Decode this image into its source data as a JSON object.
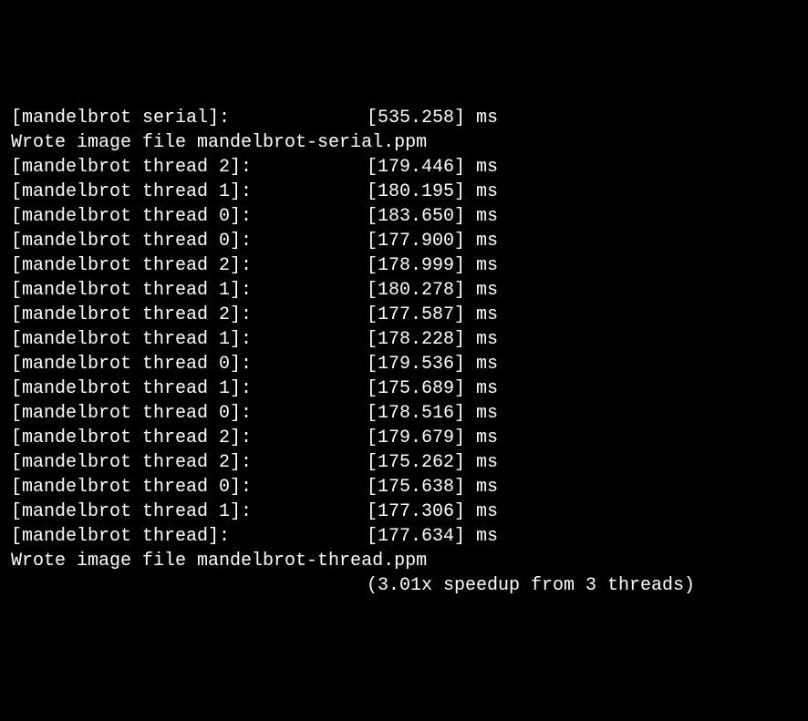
{
  "lines": [
    {
      "type": "timing",
      "label": "[mandelbrot serial]:",
      "time": "[535.258] ms"
    },
    {
      "type": "message",
      "text": "Wrote image file mandelbrot-serial.ppm"
    },
    {
      "type": "timing",
      "label": "[mandelbrot thread 2]:",
      "time": "[179.446] ms"
    },
    {
      "type": "timing",
      "label": "[mandelbrot thread 1]:",
      "time": "[180.195] ms"
    },
    {
      "type": "timing",
      "label": "[mandelbrot thread 0]:",
      "time": "[183.650] ms"
    },
    {
      "type": "timing",
      "label": "[mandelbrot thread 0]:",
      "time": "[177.900] ms"
    },
    {
      "type": "timing",
      "label": "[mandelbrot thread 2]:",
      "time": "[178.999] ms"
    },
    {
      "type": "timing",
      "label": "[mandelbrot thread 1]:",
      "time": "[180.278] ms"
    },
    {
      "type": "timing",
      "label": "[mandelbrot thread 2]:",
      "time": "[177.587] ms"
    },
    {
      "type": "timing",
      "label": "[mandelbrot thread 1]:",
      "time": "[178.228] ms"
    },
    {
      "type": "timing",
      "label": "[mandelbrot thread 0]:",
      "time": "[179.536] ms"
    },
    {
      "type": "timing",
      "label": "[mandelbrot thread 1]:",
      "time": "[175.689] ms"
    },
    {
      "type": "timing",
      "label": "[mandelbrot thread 0]:",
      "time": "[178.516] ms"
    },
    {
      "type": "timing",
      "label": "[mandelbrot thread 2]:",
      "time": "[179.679] ms"
    },
    {
      "type": "timing",
      "label": "[mandelbrot thread 2]:",
      "time": "[175.262] ms"
    },
    {
      "type": "timing",
      "label": "[mandelbrot thread 0]:",
      "time": "[175.638] ms"
    },
    {
      "type": "timing",
      "label": "[mandelbrot thread 1]:",
      "time": "[177.306] ms"
    },
    {
      "type": "timing",
      "label": "[mandelbrot thread]:",
      "time": "[177.634] ms"
    },
    {
      "type": "message",
      "text": "Wrote image file mandelbrot-thread.ppm"
    },
    {
      "type": "speedup",
      "text": "(3.01x speedup from 3 threads)"
    }
  ]
}
